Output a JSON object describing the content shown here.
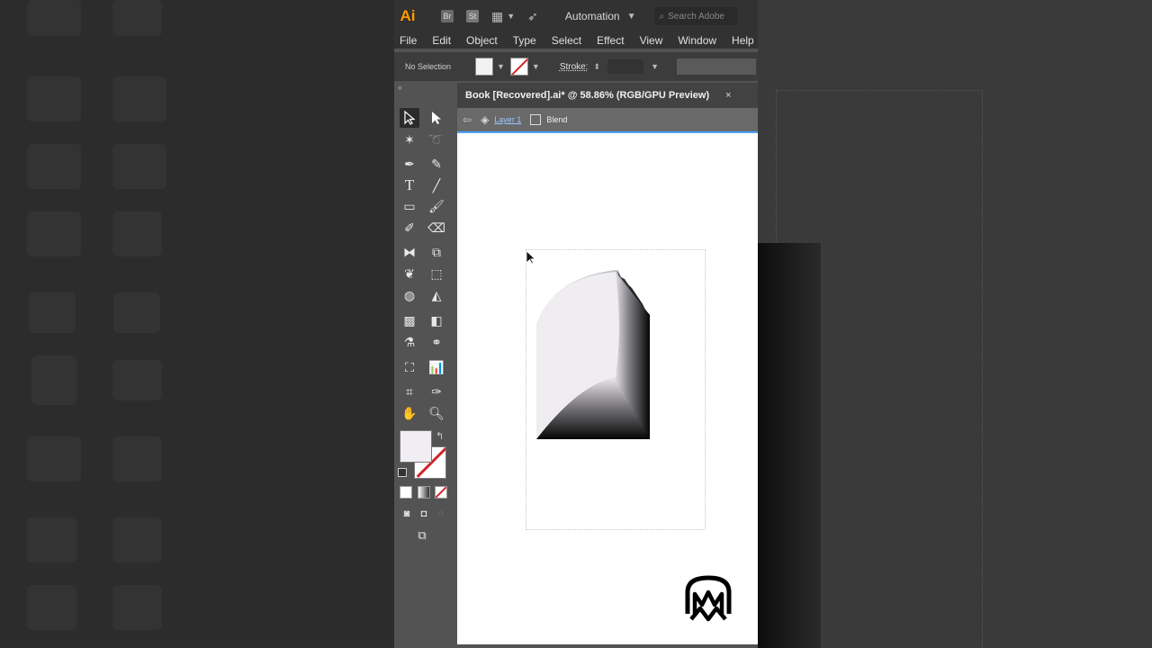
{
  "app": {
    "logo_text": "Ai",
    "bridge_label": "Br",
    "stock_label": "St",
    "workspace": "Automation",
    "search_placeholder": "Search Adobe"
  },
  "menu": [
    "File",
    "Edit",
    "Object",
    "Type",
    "Select",
    "Effect",
    "View",
    "Window",
    "Help"
  ],
  "control_bar": {
    "selection_status": "No Selection",
    "stroke_label": "Stroke:"
  },
  "document": {
    "tab_title": "Book [Recovered].ai* @ 58.86% (RGB/GPU Preview)",
    "close_glyph": "×",
    "breadcrumb_layer": "Layer 1",
    "breadcrumb_object": "Blend"
  },
  "colors": {
    "accent_orange": "#ff9a00",
    "stroke_none_red": "#d0242a",
    "fill_color": "#f0eef2",
    "canvas": "#ffffff",
    "selection_blue": "#4aa3ff"
  },
  "tools": [
    "selection-tool",
    "direct-selection-tool",
    "magic-wand-tool",
    "lasso-tool",
    "pen-tool",
    "curvature-tool",
    "type-tool",
    "line-segment-tool",
    "rectangle-tool",
    "paintbrush-tool",
    "shaper-tool",
    "eraser-tool",
    "reflect-tool",
    "scale-tool",
    "warp-tool",
    "free-transform-tool",
    "shape-builder-tool",
    "perspective-grid-tool",
    "mesh-tool",
    "gradient-tool",
    "eyedropper-tool",
    "blend-tool",
    "symbol-sprayer-tool",
    "column-graph-tool",
    "artboard-tool",
    "slice-tool",
    "hand-tool",
    "zoom-tool"
  ]
}
